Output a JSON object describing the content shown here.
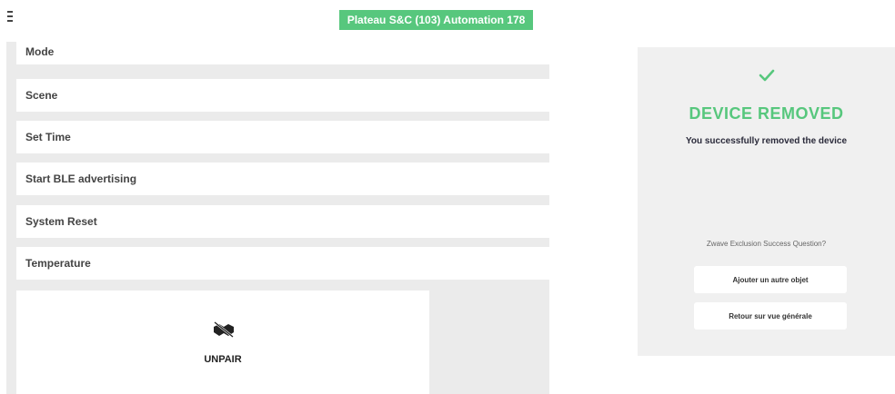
{
  "header": {
    "title": "Plateau S&C (103) Automation 178"
  },
  "commands": [
    {
      "label": "Mode"
    },
    {
      "label": "Scene"
    },
    {
      "label": "Set Time"
    },
    {
      "label": "Start BLE advertising"
    },
    {
      "label": "System Reset"
    },
    {
      "label": "Temperature"
    }
  ],
  "unpair": {
    "label": "UNPAIR",
    "icon": "unlink-handshake-icon"
  },
  "result": {
    "icon": "checkmark-icon",
    "title": "DEVICE REMOVED",
    "subtitle": "You successfully removed the device",
    "question": "Zwave Exclusion Success Question?",
    "buttons": [
      {
        "label": "Ajouter un autre objet"
      },
      {
        "label": "Retour sur vue générale"
      }
    ]
  },
  "colors": {
    "accent": "#57c77d",
    "panel_bg": "#ebebeb"
  }
}
